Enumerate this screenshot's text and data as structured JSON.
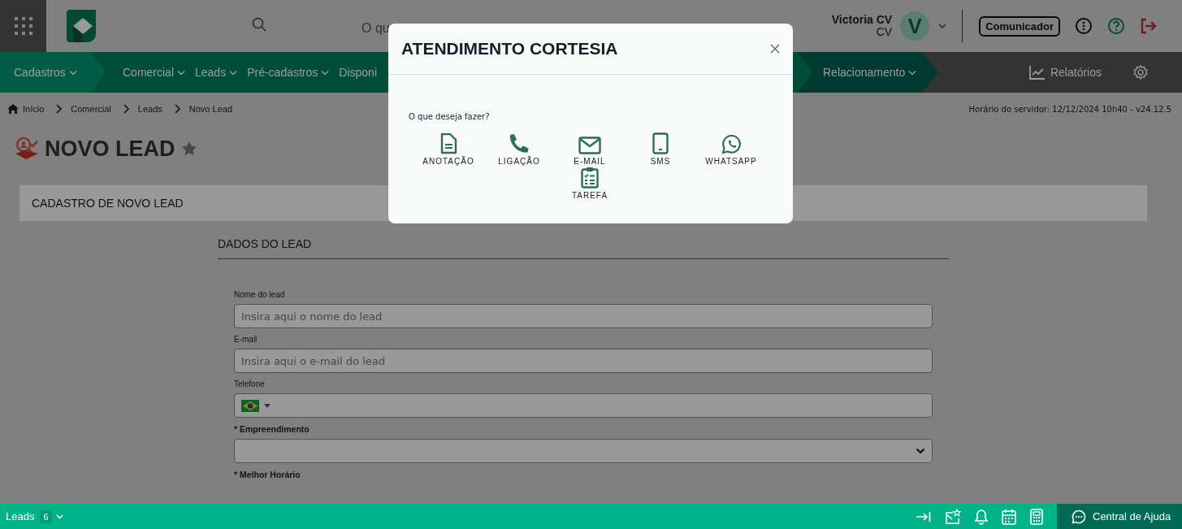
{
  "topbar": {
    "search_text": "O qu",
    "user": {
      "name": "Victoria CV",
      "role": "CV",
      "initial": "V"
    },
    "communicator_button": "Comunicador"
  },
  "nav": {
    "segments": [
      {
        "items": [
          {
            "label": "Cadastros",
            "dropdown": true
          }
        ]
      },
      {
        "items": [
          {
            "label": "Comercial",
            "dropdown": true
          },
          {
            "label": "Leads",
            "dropdown": true
          },
          {
            "label": "Pré-cadastros",
            "dropdown": true
          },
          {
            "label": "Disponi",
            "dropdown": false
          }
        ]
      },
      {
        "items": [
          {
            "label": "Relacionamento",
            "dropdown": true
          }
        ]
      }
    ],
    "reports": "Relatórios"
  },
  "breadcrumb": [
    "Início",
    "Comercial",
    "Leads",
    "Novo Lead"
  ],
  "server_time": "Horário do servidor: 12/12/2024 10h40 - v24.12.5",
  "page_title": "NOVO LEAD",
  "favorite": false,
  "card_header": "CADASTRO DE NOVO LEAD",
  "section_title": "DADOS DO LEAD",
  "fields": [
    {
      "label": "Nome do lead",
      "kind": "text",
      "required": false,
      "placeholder": "Insira aqui o nome do lead"
    },
    {
      "label": "E-mail",
      "kind": "text",
      "required": false,
      "placeholder": "Insira aqui o e-mail do lead"
    },
    {
      "label": "Telefone",
      "kind": "phone",
      "required": false
    },
    {
      "label": "* Empreendimento",
      "kind": "select",
      "required": true
    },
    {
      "label": "* Melhor Horário",
      "kind": "label",
      "required": true
    }
  ],
  "modal": {
    "title": "ATENDIMENTO CORTESIA",
    "prompt": "O que deseja fazer?",
    "actions": [
      {
        "label": "ANOTAÇÃO",
        "kind": "note"
      },
      {
        "label": "LIGAÇÃO",
        "kind": "call"
      },
      {
        "label": "E-MAIL",
        "kind": "email"
      },
      {
        "label": "SMS",
        "kind": "sms"
      },
      {
        "label": "WHATSAPP",
        "kind": "whatsapp"
      },
      {
        "label": "TAREFA",
        "kind": "task"
      }
    ]
  },
  "bottom_bar": {
    "label": "Leads",
    "count": "6",
    "help": "Central de Ajuda"
  }
}
